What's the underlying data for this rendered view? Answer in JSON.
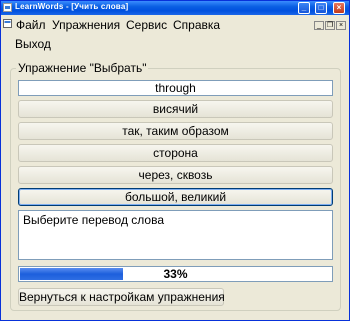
{
  "window": {
    "title": "LearnWords - [Учить слова]"
  },
  "menu": {
    "items": [
      "Файл",
      "Упражнения",
      "Сервис",
      "Справка"
    ],
    "exit_label": "Выход",
    "mdi_buttons": [
      "_",
      "❐",
      "×"
    ]
  },
  "exercise": {
    "group_title": "Упражнение \"Выбрать\"",
    "word": "through",
    "options": [
      {
        "label": "висячий",
        "selected": false
      },
      {
        "label": "так, таким образом",
        "selected": false
      },
      {
        "label": "сторона",
        "selected": false
      },
      {
        "label": "через, сквозь",
        "selected": false
      },
      {
        "label": "большой, великий",
        "selected": true
      }
    ],
    "message": "Выберите перевод слова",
    "progress_percent": 33,
    "progress_label": "33%",
    "back_label": "Вернуться к настройкам упражнения"
  },
  "colors": {
    "titlebar": "#0a5fe3",
    "progress": "#1d5fdc"
  }
}
